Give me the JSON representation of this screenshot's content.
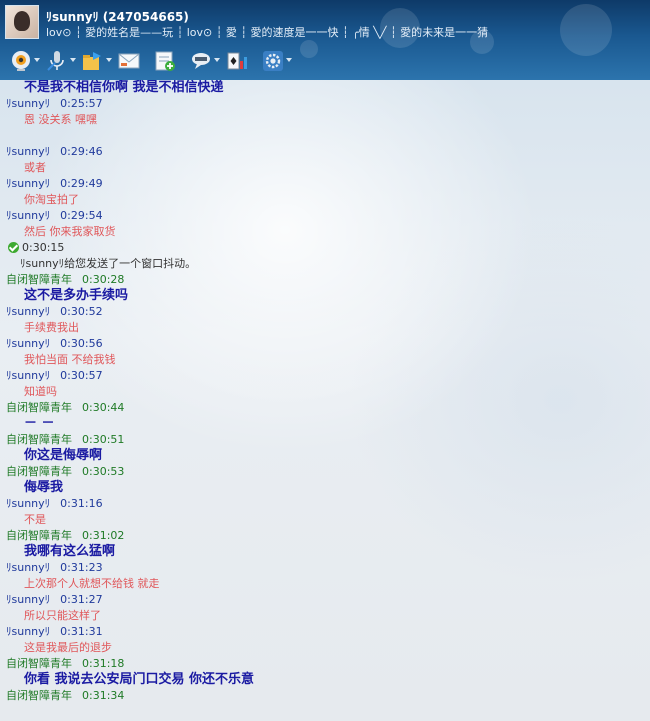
{
  "header": {
    "contact_name": "ﾘsunnyﾘ (247054665)",
    "signature": "lov⊙ ┆ 愛的姓名是——玩 ┆ lov⊙ ┆ 愛 ┆ 愛的速度是一一快 ┆ ╭情 ╲╱ ┆ 愛的未来是一一猜",
    "toolbar_icons": [
      "webcam-icon",
      "microphone-icon",
      "send-file-icon",
      "email-icon",
      "add-app-icon",
      "chat-bubble-icon",
      "cards-game-icon",
      "settings-icon"
    ]
  },
  "messages": [
    {
      "type": "body",
      "style": "big",
      "text": "不是我不相信你啊      我是不相信快递"
    },
    {
      "type": "hdr",
      "who": "sunny",
      "sender": "ﾘsunnyﾘ",
      "time": "0:25:57"
    },
    {
      "type": "body",
      "style": "pink",
      "text": "恩 没关系 嘿嘿"
    },
    {
      "type": "gap"
    },
    {
      "type": "hdr",
      "who": "sunny",
      "sender": "ﾘsunnyﾘ",
      "time": "0:29:46"
    },
    {
      "type": "body",
      "style": "pink",
      "text": "或者"
    },
    {
      "type": "hdr",
      "who": "sunny",
      "sender": "ﾘsunnyﾘ",
      "time": "0:29:49"
    },
    {
      "type": "body",
      "style": "pink",
      "text": "你淘宝拍了"
    },
    {
      "type": "hdr",
      "who": "sunny",
      "sender": "ﾘsunnyﾘ",
      "time": "0:29:54"
    },
    {
      "type": "body",
      "style": "pink",
      "text": "然后 你来我家取货"
    },
    {
      "type": "systime",
      "time": "0:30:15"
    },
    {
      "type": "sys",
      "text": "ﾘsunnyﾘ给您发送了一个窗口抖动。"
    },
    {
      "type": "hdr",
      "who": "other",
      "sender": "自闭智障青年",
      "time": "0:30:28"
    },
    {
      "type": "body",
      "style": "big",
      "text": "这不是多办手续吗"
    },
    {
      "type": "hdr",
      "who": "sunny",
      "sender": "ﾘsunnyﾘ",
      "time": "0:30:52"
    },
    {
      "type": "body",
      "style": "pink",
      "text": "手续费我出"
    },
    {
      "type": "hdr",
      "who": "sunny",
      "sender": "ﾘsunnyﾘ",
      "time": "0:30:56"
    },
    {
      "type": "body",
      "style": "pink",
      "text": "我怕当面 不给我钱"
    },
    {
      "type": "hdr",
      "who": "sunny",
      "sender": "ﾘsunnyﾘ",
      "time": "0:30:57"
    },
    {
      "type": "body",
      "style": "pink",
      "text": "知道吗"
    },
    {
      "type": "hdr",
      "who": "other",
      "sender": "自闭智障青年",
      "time": "0:30:44"
    },
    {
      "type": "body",
      "style": "big",
      "text": "  －  －"
    },
    {
      "type": "hdr",
      "who": "other",
      "sender": "自闭智障青年",
      "time": "0:30:51"
    },
    {
      "type": "body",
      "style": "big",
      "text": "你这是侮辱啊"
    },
    {
      "type": "hdr",
      "who": "other",
      "sender": "自闭智障青年",
      "time": "0:30:53"
    },
    {
      "type": "body",
      "style": "big",
      "text": "侮辱我"
    },
    {
      "type": "hdr",
      "who": "sunny",
      "sender": "ﾘsunnyﾘ",
      "time": "0:31:16"
    },
    {
      "type": "body",
      "style": "pink",
      "text": "不是"
    },
    {
      "type": "hdr",
      "who": "other",
      "sender": "自闭智障青年",
      "time": "0:31:02"
    },
    {
      "type": "body",
      "style": "big",
      "text": "我哪有这么猛啊"
    },
    {
      "type": "hdr",
      "who": "sunny",
      "sender": "ﾘsunnyﾘ",
      "time": "0:31:23"
    },
    {
      "type": "body",
      "style": "pink",
      "text": "上次那个人就想不给钱 就走"
    },
    {
      "type": "hdr",
      "who": "sunny",
      "sender": "ﾘsunnyﾘ",
      "time": "0:31:27"
    },
    {
      "type": "body",
      "style": "pink",
      "text": "所以只能这样了"
    },
    {
      "type": "hdr",
      "who": "sunny",
      "sender": "ﾘsunnyﾘ",
      "time": "0:31:31"
    },
    {
      "type": "body",
      "style": "pink",
      "text": "这是我最后的退步"
    },
    {
      "type": "hdr",
      "who": "other",
      "sender": "自闭智障青年",
      "time": "0:31:18"
    },
    {
      "type": "body",
      "style": "big",
      "text": "你看    我说去公安局门口交易      你还不乐意"
    },
    {
      "type": "hdr",
      "who": "other",
      "sender": "自闭智障青年",
      "time": "0:31:34"
    }
  ]
}
